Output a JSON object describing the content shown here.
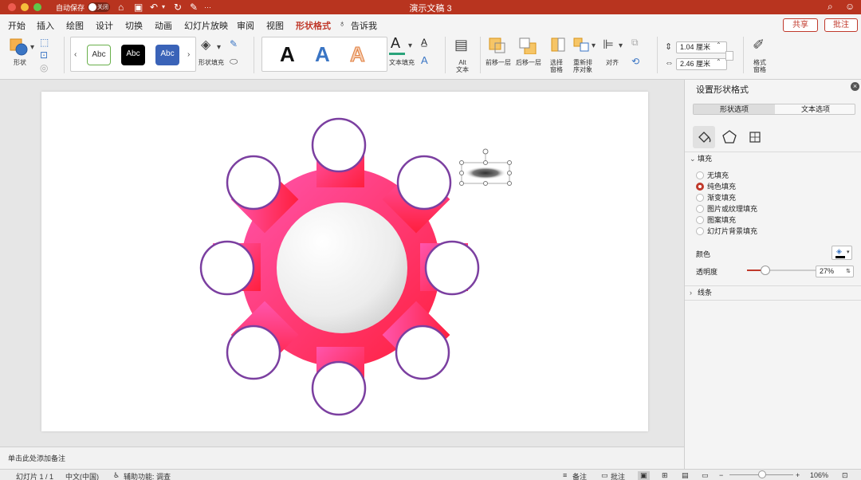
{
  "titlebar": {
    "autosave_label": "自动保存",
    "autosave_state": "关闭",
    "doc_title": "演示文稿 3",
    "color": "#b8341f"
  },
  "menu": {
    "tabs": [
      "开始",
      "插入",
      "绘图",
      "设计",
      "切换",
      "动画",
      "幻灯片放映",
      "审阅",
      "视图",
      "形状格式",
      "告诉我"
    ],
    "active_tab": "形状格式",
    "share": "共享",
    "comment": "批注"
  },
  "ribbon": {
    "shape_label": "形状",
    "style_swatches": [
      "Abc",
      "Abc",
      "Abc"
    ],
    "shape_fill_label": "形状填充",
    "wordart_samples": [
      "A",
      "A",
      "A"
    ],
    "text_fill_label": "文本填充",
    "alt_text_label_1": "Alt",
    "alt_text_label_2": "文本",
    "bring_forward": "前移一层",
    "send_backward": "后移一层",
    "selection_pane_1": "选择",
    "selection_pane_2": "窗格",
    "reorder_1": "重新排",
    "reorder_2": "序对象",
    "align": "对齐",
    "height_value": "1.04 厘米",
    "width_value": "2.46 厘米",
    "format_pane_1": "格式",
    "format_pane_2": "窗格"
  },
  "slide": {
    "gear_gradient_top": "#ff4fa3",
    "gear_gradient_bottom": "#ff1f3d",
    "circle_stroke": "#7b3fa0"
  },
  "notes": {
    "placeholder": "单击此处添加备注"
  },
  "pane": {
    "title": "设置形状格式",
    "tab_shape": "形状选项",
    "tab_text": "文本选项",
    "fill_section": "填充",
    "fill_options": [
      "无填充",
      "纯色填充",
      "渐变填充",
      "图片或纹理填充",
      "图案填充",
      "幻灯片背景填充"
    ],
    "fill_selected": "纯色填充",
    "color_label": "颜色",
    "transparency_label": "透明度",
    "transparency_value": "27%",
    "transparency_fraction": 0.27,
    "line_section": "线条"
  },
  "statusbar": {
    "slide_info": "幻灯片 1 / 1",
    "language": "中文(中国)",
    "accessibility": "辅助功能: 调查",
    "notes": "备注",
    "comments": "批注",
    "zoom": "106%"
  }
}
